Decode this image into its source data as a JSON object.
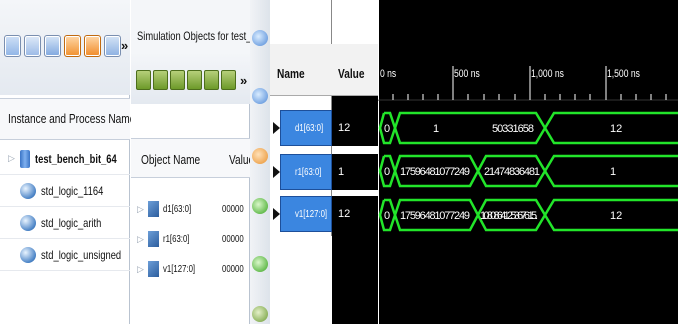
{
  "instance_panel": {
    "column_header": "Instance and Process Name",
    "items": [
      {
        "label": "test_bench_bit_64",
        "icon": "module-icon"
      },
      {
        "label": "std_logic_1164",
        "icon": "package-icon"
      },
      {
        "label": "std_logic_arith",
        "icon": "package-icon"
      },
      {
        "label": "std_logic_unsigned",
        "icon": "package-icon"
      }
    ],
    "overflow_label": "»"
  },
  "objects_panel": {
    "title": "Simulation Objects for test_ben...",
    "overflow_label": "»",
    "columns": [
      "Object Name",
      "Value"
    ],
    "items": [
      {
        "name": "d1[63:0]",
        "value": "00000"
      },
      {
        "name": "r1[63:0]",
        "value": "00000"
      },
      {
        "name": "v1[127:0]",
        "value": "00000"
      }
    ]
  },
  "wave_window": {
    "name_header": "Name",
    "value_header": "Value",
    "time_ticks": [
      "0 ns",
      "500 ns",
      "1,000 ns",
      "1,500 ns"
    ],
    "signals": [
      {
        "name": "d1[63:0]",
        "value": "12",
        "segments": [
          "0",
          "1",
          "50331658",
          "12"
        ]
      },
      {
        "name": "r1[63:0]",
        "value": "1",
        "segments": [
          "0",
          "17596481077249",
          "21474836481",
          "1"
        ]
      },
      {
        "name": "v1[127:0]",
        "value": "12",
        "segments": [
          "0",
          "17596481077249",
          "10808641253676 15...",
          "12"
        ]
      }
    ],
    "wave_color": "#22e52a"
  }
}
